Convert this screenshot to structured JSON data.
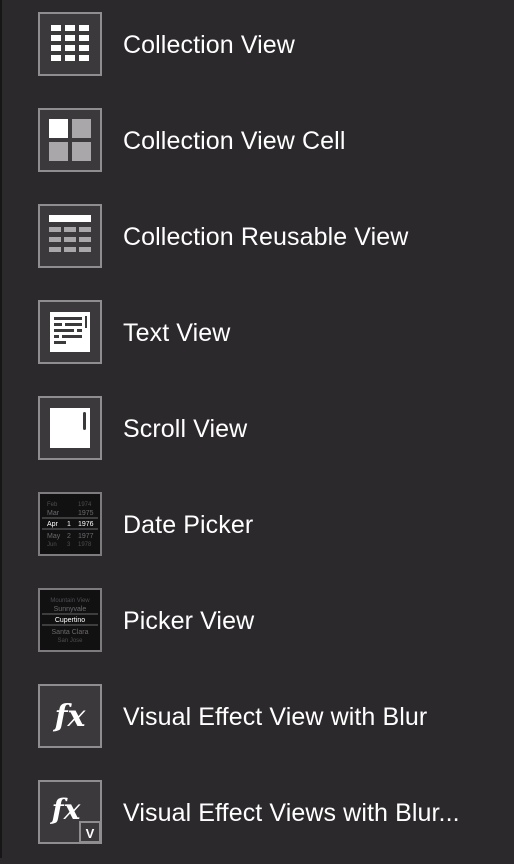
{
  "library": {
    "items": [
      {
        "label": "Collection View",
        "icon": "collection-view-icon"
      },
      {
        "label": "Collection View Cell",
        "icon": "collection-view-cell-icon"
      },
      {
        "label": "Collection Reusable View",
        "icon": "collection-reusable-view-icon"
      },
      {
        "label": "Text View",
        "icon": "text-view-icon"
      },
      {
        "label": "Scroll View",
        "icon": "scroll-view-icon"
      },
      {
        "label": "Date Picker",
        "icon": "date-picker-icon"
      },
      {
        "label": "Picker View",
        "icon": "picker-view-icon"
      },
      {
        "label": "Visual Effect View with Blur",
        "icon": "visual-effect-icon"
      },
      {
        "label": "Visual Effect Views with Blur...",
        "icon": "visual-effect-vibrancy-icon"
      }
    ]
  },
  "date_picker_icon": {
    "rows": [
      [
        "Feb",
        "",
        "1974"
      ],
      [
        "Mar",
        "",
        "1975"
      ],
      [
        "Apr",
        "1",
        "1976"
      ],
      [
        "May",
        "2",
        "1977"
      ],
      [
        "Jun",
        "3",
        "1978"
      ]
    ]
  },
  "picker_view_icon": {
    "rows": [
      "Mountain View",
      "Sunnyvale",
      "Cupertino",
      "Santa Clara",
      "San Jose"
    ]
  },
  "visual_effect_icon": {
    "glyph": "fx",
    "badge": "V"
  },
  "colors": {
    "background": "#2b292b",
    "icon_border": "#8f8d90",
    "icon_fill": "#3b393b",
    "text": "#ffffff"
  }
}
